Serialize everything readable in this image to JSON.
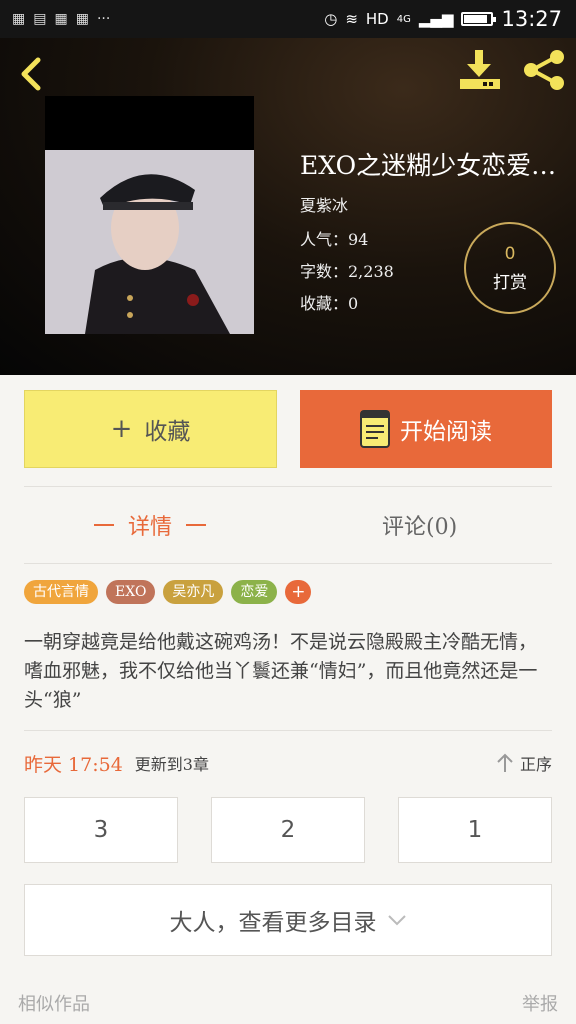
{
  "status_bar": {
    "time": "13:27",
    "network": "HD",
    "signal_type": "4G"
  },
  "book": {
    "title": "EXO之迷糊少女恋爱…",
    "author": "夏紫冰",
    "popularity": "人气：94",
    "word_count": "字数：2,238",
    "favorites": "收藏：0"
  },
  "tip": {
    "count": "0",
    "label": "打赏"
  },
  "actions": {
    "favorite_label": "收藏",
    "read_label": "开始阅读"
  },
  "tabs": {
    "detail": "详情",
    "comment": "评论(0)"
  },
  "tags": [
    {
      "label": "古代言情",
      "color": "#f0a53c"
    },
    {
      "label": "EXO",
      "color": "#c0745a"
    },
    {
      "label": "吴亦凡",
      "color": "#c9a13e"
    },
    {
      "label": "恋爱",
      "color": "#8cb24a"
    }
  ],
  "intro": "一朝穿越竟是给他戴这碗鸡汤！不是说云隐殿殿主冷酷无情，嗜血邪魅，我不仅给他当丫鬟还兼“情妇”，而且他竟然还是一头“狼”",
  "update": {
    "time": "昨天 17:54",
    "text": "更新到3章",
    "sort_label": "正序"
  },
  "chapters": [
    "3",
    "2",
    "1"
  ],
  "more_catalog": "大人，查看更多目录",
  "footer": {
    "similar": "相似作品",
    "report": "举报"
  },
  "colors": {
    "accent": "#e8693a",
    "favorite_bg": "#f8ec74",
    "gold": "#d9b860"
  }
}
